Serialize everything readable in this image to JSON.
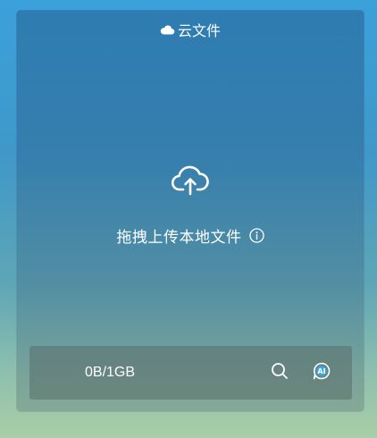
{
  "header": {
    "icon": "cloud-icon",
    "title": "云文件"
  },
  "upload": {
    "icon": "cloud-upload-icon",
    "label": "拖拽上传本地文件",
    "info_icon": "info-icon"
  },
  "footer": {
    "storage_usage": "0B/1GB",
    "search_icon": "search-icon",
    "ai_icon": "ai-assistant-icon",
    "ai_text": "AI"
  },
  "colors": {
    "accent_ai": "#3aa7e6",
    "text": "#ffffff"
  }
}
